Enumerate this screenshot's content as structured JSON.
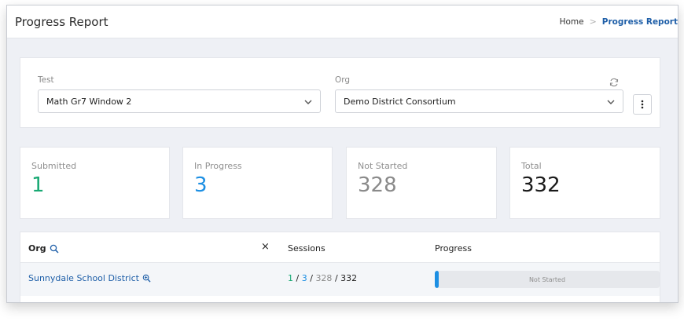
{
  "header": {
    "title": "Progress Report",
    "breadcrumb": {
      "home": "Home",
      "separator": ">",
      "current": "Progress Report"
    }
  },
  "filters": {
    "test": {
      "label": "Test",
      "value": "Math Gr7 Window 2"
    },
    "org": {
      "label": "Org",
      "value": "Demo District Consortium"
    },
    "icons": {
      "refresh": "refresh-icon",
      "more": "more-vertical-icon",
      "chevron": "chevron-down-icon"
    }
  },
  "stats": {
    "submitted": {
      "label": "Submitted",
      "value": "1",
      "color": "#19a974"
    },
    "in_progress": {
      "label": "In Progress",
      "value": "3",
      "color": "#1c8fe3"
    },
    "not_started": {
      "label": "Not Started",
      "value": "328",
      "color": "#8a8a8a"
    },
    "total": {
      "label": "Total",
      "value": "332",
      "color": "#1a1a1a"
    }
  },
  "table": {
    "columns": {
      "org": "Org",
      "clear": "×",
      "sessions": "Sessions",
      "progress": "Progress"
    },
    "rows": [
      {
        "org": "Sunnydale School District",
        "sessions": {
          "submitted": "1",
          "sep1": "/",
          "in_progress": "3",
          "sep2": "/",
          "not_started": "328",
          "sep3": "/",
          "total": "332"
        },
        "progress_fraction": 0.009,
        "progress_label": "Not Started"
      }
    ]
  },
  "colors": {
    "link": "#1f5fa8",
    "accent": "#1c8fe3",
    "submitted": "#19a974",
    "muted": "#8a8a8a"
  }
}
